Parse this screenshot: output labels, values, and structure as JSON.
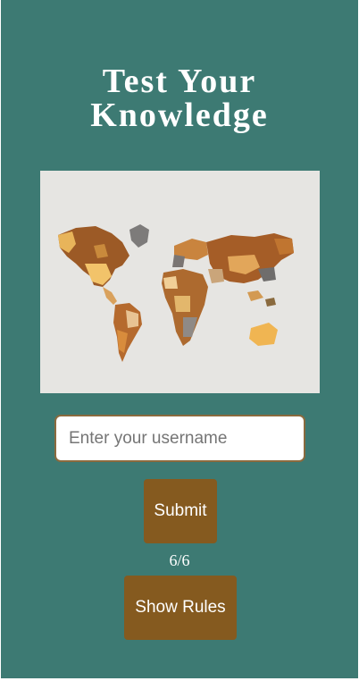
{
  "title": {
    "line1": "Test Your",
    "line2": "Knowledge"
  },
  "image": {
    "subject": "wooden-world-map-photo"
  },
  "username_input": {
    "placeholder": "Enter your username",
    "value": ""
  },
  "submit_button": {
    "label": "Submit"
  },
  "score": {
    "text": "6/6"
  },
  "rules_button": {
    "label": "Show Rules"
  },
  "colors": {
    "background": "#3d7a73",
    "button": "#855a1f",
    "input_border": "#8a6a3e"
  }
}
